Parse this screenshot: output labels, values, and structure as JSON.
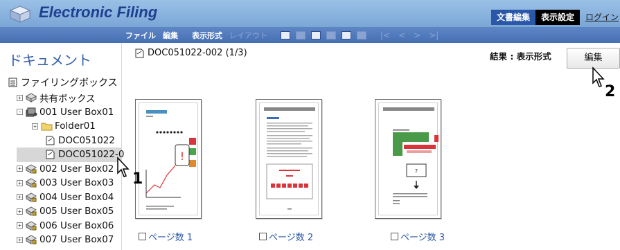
{
  "app": {
    "title": "Electronic Filing"
  },
  "top_nav": {
    "doc_edit": "文書編集",
    "display_settings": "表示設定",
    "login": "ログイン"
  },
  "toolbar": {
    "file": "ファイル",
    "edit": "編集",
    "display_format": "表示形式",
    "layout": "レイアウト",
    "nav_glyphs": [
      "|<",
      "<",
      ">",
      ">|"
    ]
  },
  "left_panel": {
    "heading": "ドキュメント",
    "root": "ファイリングボックス",
    "tree": [
      {
        "pm": "+",
        "label": "共有ボックス",
        "icon": "shared-box-icon",
        "level": 1
      },
      {
        "pm": "-",
        "label": "001 User Box01",
        "icon": "user-box-icon",
        "level": 1
      },
      {
        "pm": "+",
        "label": "Folder01",
        "icon": "folder-icon",
        "level": 2
      },
      {
        "pm": "",
        "label": "DOC051022",
        "icon": "document-icon",
        "level": 3
      },
      {
        "pm": "",
        "label": "DOC051022-0",
        "icon": "document-icon",
        "level": 3,
        "selected": true
      },
      {
        "pm": "+",
        "label": "002 User Box02",
        "icon": "user-box-icon",
        "level": 1
      },
      {
        "pm": "+",
        "label": "003 User Box03",
        "icon": "user-box-icon",
        "level": 1
      },
      {
        "pm": "+",
        "label": "004 User Box04",
        "icon": "user-box-icon",
        "level": 1
      },
      {
        "pm": "+",
        "label": "005 User Box05",
        "icon": "user-box-icon",
        "level": 1
      },
      {
        "pm": "+",
        "label": "006 User Box06",
        "icon": "user-box-icon",
        "level": 1
      },
      {
        "pm": "+",
        "label": "007 User Box07",
        "icon": "user-box-icon",
        "level": 1
      }
    ]
  },
  "main": {
    "document_name": "DOC051022-002 (1/3)",
    "result_label": "結果 : 表示形式",
    "edit_button": "編集",
    "pages": [
      {
        "label": "ページ数 1"
      },
      {
        "label": "ページ数 2"
      },
      {
        "label": "ページ数 3"
      }
    ]
  },
  "callouts": {
    "step1": "1",
    "step2": "2"
  },
  "colors": {
    "header": "#8fb6e0",
    "toolbar": "#4f79bd",
    "accent_text": "#2a57a8",
    "title": "#1f3f8f"
  }
}
